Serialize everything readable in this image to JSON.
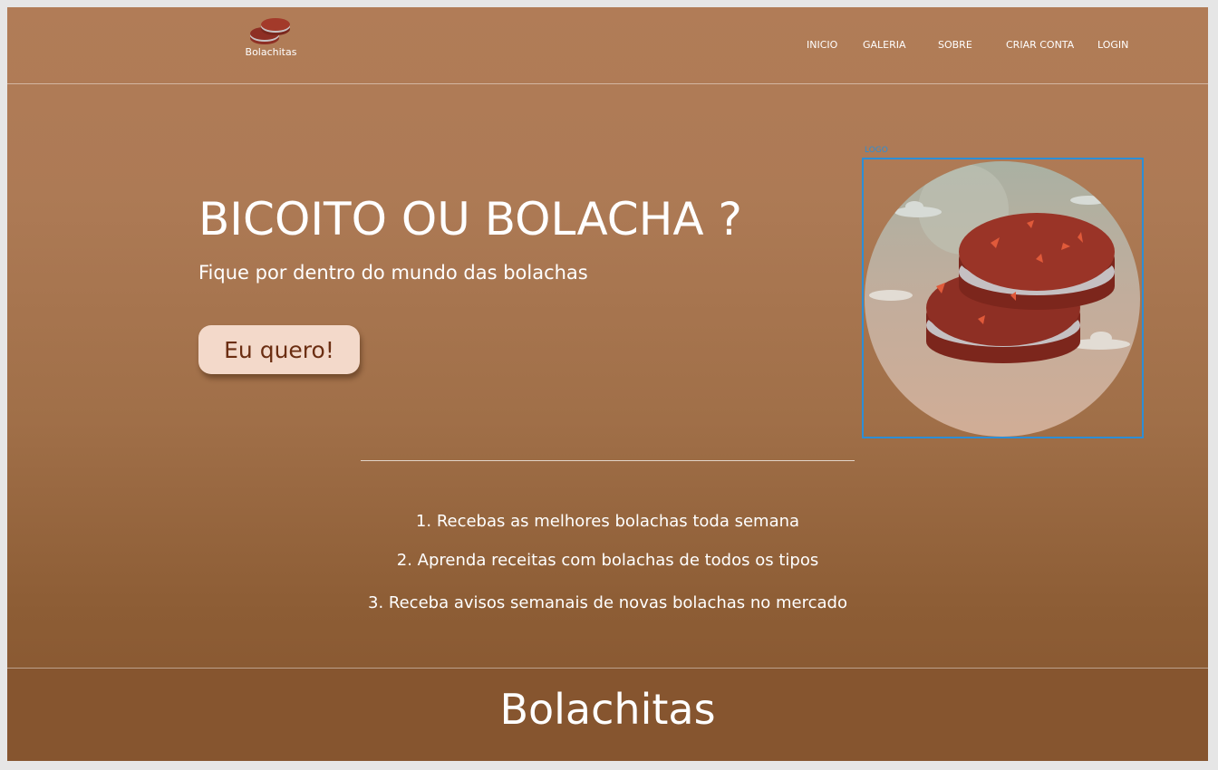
{
  "header": {
    "brand_name": "Bolachitas",
    "nav": [
      {
        "label": "INICIO"
      },
      {
        "label": "GALERIA"
      },
      {
        "label": "SOBRE"
      },
      {
        "label": "CRIAR CONTA"
      },
      {
        "label": "LOGIN"
      }
    ]
  },
  "hero": {
    "title": "BICOITO OU BOLACHA ?",
    "subtitle": "Fique por dentro do mundo das bolachas",
    "cta_label": "Eu quero!",
    "image_tag": "LOGO"
  },
  "features": [
    "1. Recebas as melhores bolachas toda semana",
    "2. Aprenda receitas com bolachas de todos os tipos",
    "3. Receba avisos semanais de novas bolachas no mercado"
  ],
  "footer": {
    "title": "Bolachitas"
  },
  "colors": {
    "background": "#ad7a55",
    "cta_background": "#f3d9ca",
    "cta_text": "#6b2e12",
    "cookie": "#8e2f24",
    "selection_border": "#2c8ed6"
  }
}
